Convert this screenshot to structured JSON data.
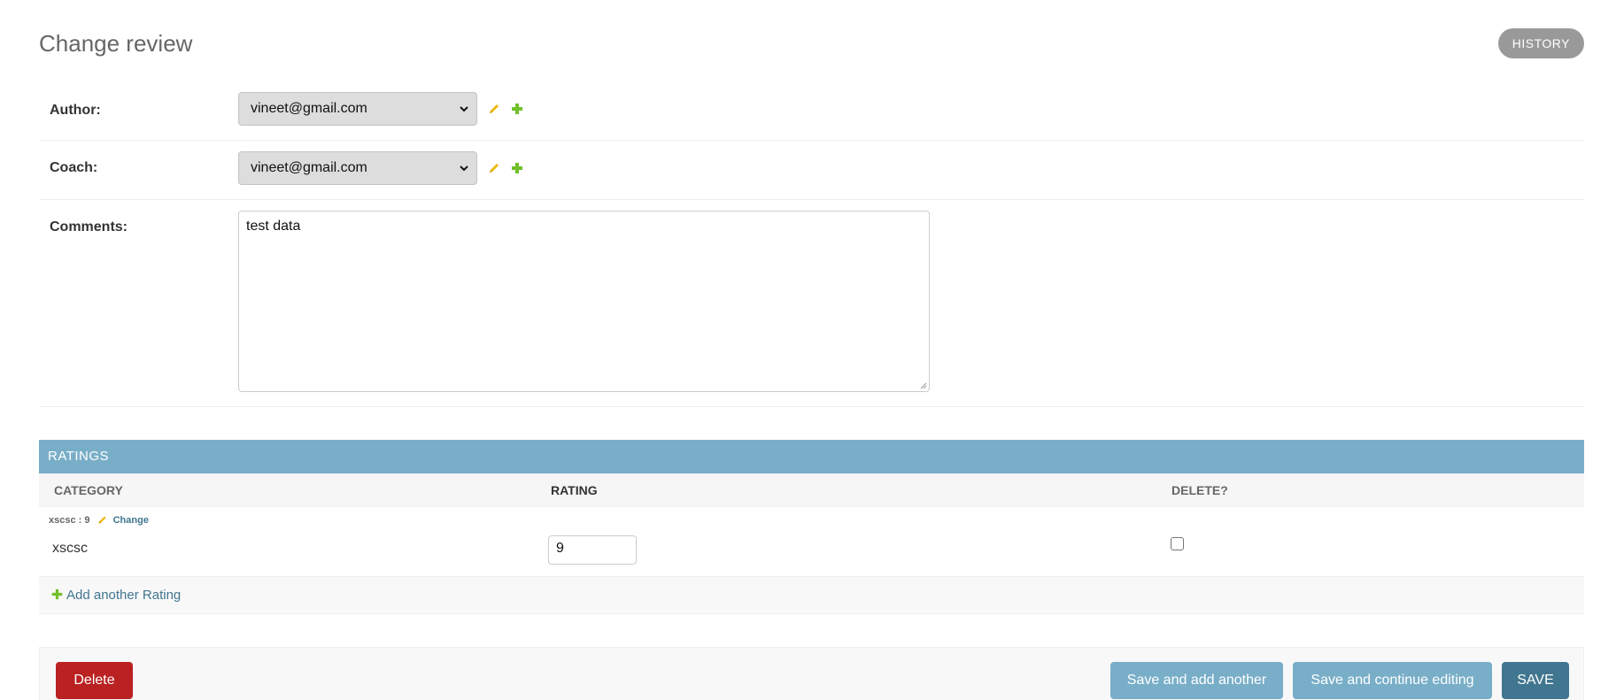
{
  "page": {
    "title": "Change review",
    "history_label": "History"
  },
  "form": {
    "author": {
      "label": "Author:",
      "selected": "vineet@gmail.com"
    },
    "coach": {
      "label": "Coach:",
      "selected": "vineet@gmail.com"
    },
    "comments": {
      "label": "Comments:",
      "value": "test data"
    }
  },
  "ratings": {
    "heading": "Ratings",
    "columns": [
      "Category",
      "Rating",
      "Delete?"
    ],
    "rows": [
      {
        "original": "xscsc : 9",
        "change_label": "Change",
        "category": "xscsc",
        "rating": "9",
        "delete": false
      }
    ],
    "add_label": "Add another Rating"
  },
  "submit": {
    "delete_label": "Delete",
    "save_add_another_label": "Save and add another",
    "save_continue_label": "Save and continue editing",
    "save_label": "Save"
  },
  "colors": {
    "module_header": "#79aec8",
    "primary": "#417690",
    "delete": "#ba2121",
    "edit_icon": "#efb80b",
    "add_icon": "#70bf2b"
  }
}
